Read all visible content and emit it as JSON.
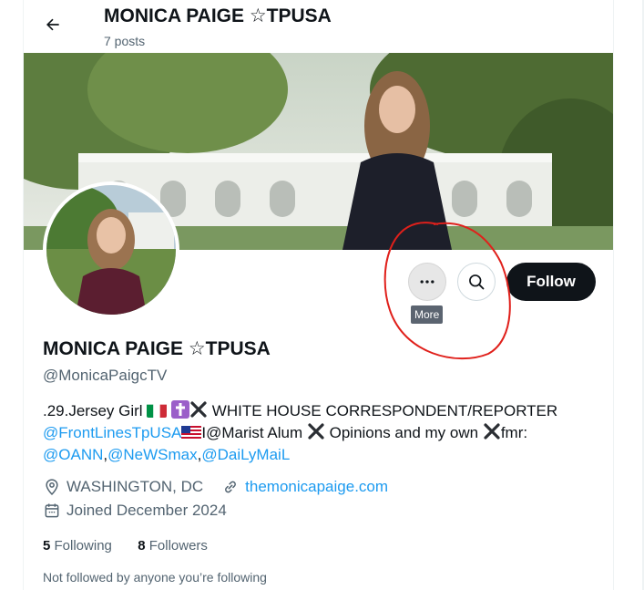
{
  "header": {
    "name": "MONICA PAIGE ☆TPUSA",
    "posts": "7 posts"
  },
  "actions": {
    "more_tooltip": "More",
    "follow_label": "Follow"
  },
  "profile": {
    "name": "MONICA PAIGE ☆TPUSA",
    "handle": "@MonicaPaigcTV",
    "bio": {
      "part1": ".29.Jersey Girl ",
      "part2": "WHITE HOUSE CORRESPONDENT/REPORTER",
      "mention1": "@FrontLinesTpUSA",
      "part3": "I@Marist Alum ",
      "part4": "Opinions and my own ",
      "part5": "fmr:",
      "mention2": "@OANN",
      "sep1": ",",
      "mention3": "@NeWSmax",
      "sep2": ",",
      "mention4": "@DaiLyMaiL"
    },
    "location": "WASHINGTON, DC",
    "website": "themonicapaige.com",
    "joined": "Joined December 2024",
    "following_count": "5",
    "following_label": "Following",
    "followers_count": "8",
    "followers_label": "Followers",
    "not_followed": "Not followed by anyone you’re following"
  },
  "colors": {
    "link": "#1d9bf0",
    "secondary_text": "#536471",
    "annotation_circle": "#e0201b"
  },
  "icons": [
    "back-arrow-icon",
    "more-dots-icon",
    "search-icon",
    "location-pin-icon",
    "link-icon",
    "calendar-icon",
    "italy-flag-icon",
    "latin-cross-icon",
    "cross-mark-icon",
    "us-flag-icon"
  ]
}
